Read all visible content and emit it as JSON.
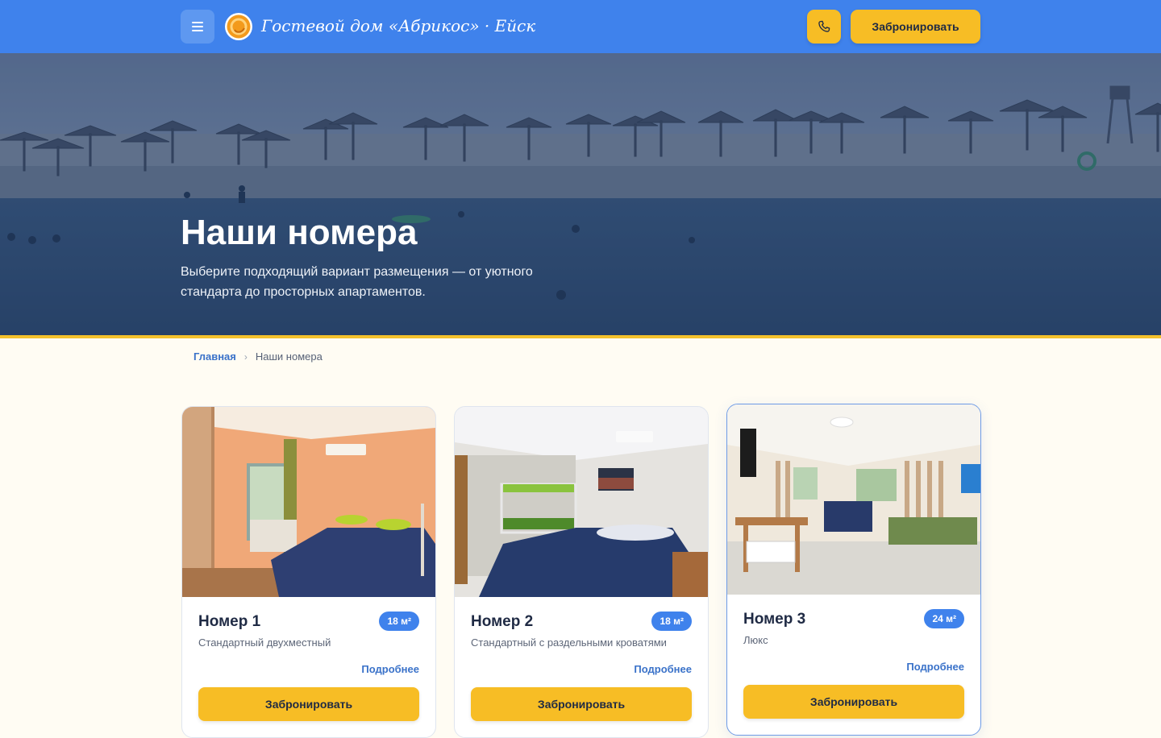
{
  "header": {
    "brand": "Гостевой дом «Абрикос» · Ейск",
    "menu_icon": "hamburger-icon",
    "logo_icon": "apricot-logo-icon",
    "phone_icon": "phone-icon",
    "book_label": "Забронировать",
    "colors": {
      "bar": "#3f82ec",
      "accent": "#f7bd25"
    }
  },
  "hero": {
    "title": "Наши номера",
    "subtitle": "Выберите подходящий вариант размещения — от уютного стандарта до просторных апартаментов."
  },
  "breadcrumb": {
    "home": "Главная",
    "separator": "›",
    "current": "Наши номера"
  },
  "rooms": [
    {
      "title": "Номер 1",
      "area": "18 м²",
      "description": "Стандартный двухместный",
      "more": "Подробнее",
      "book": "Забронировать"
    },
    {
      "title": "Номер 2",
      "area": "18 м²",
      "description": "Стандартный с раздельными кроватями",
      "more": "Подробнее",
      "book": "Забронировать"
    },
    {
      "title": "Номер 3",
      "area": "24 м²",
      "description": "Люкс",
      "more": "Подробнее",
      "book": "Забронировать"
    }
  ]
}
